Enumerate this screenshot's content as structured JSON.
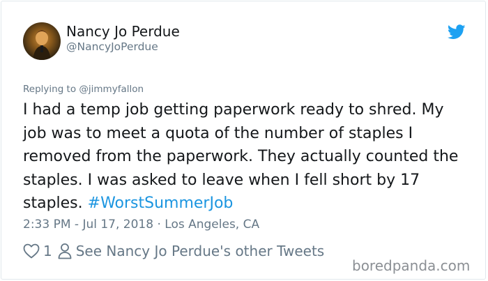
{
  "author": {
    "name": "Nancy Jo Perdue",
    "handle": "@NancyJoPerdue"
  },
  "tweet": {
    "replying_to": "Replying to @jimmyfallon",
    "text": "I had a temp job getting paperwork ready to shred. My job was to meet a quota of the number of staples I removed from the paperwork.  They actually counted the staples.  I was asked to leave when I fell short by 17 staples. ",
    "hashtag": "#WorstSummerJob",
    "timestamp": "2:33 PM - Jul 17, 2018",
    "separator": "·",
    "location": "Los Angeles, CA"
  },
  "actions": {
    "like_count": "1",
    "other_tweets_label": "See Nancy Jo Perdue's other Tweets"
  },
  "watermark": "boredpanda.com",
  "colors": {
    "text": "#14171a",
    "secondary": "#657786",
    "link": "#1b95e0",
    "twitter_blue": "#1da1f2",
    "border": "#e1e8ed"
  },
  "icons": [
    "twitter-bird-icon",
    "heart-icon",
    "person-icon"
  ]
}
